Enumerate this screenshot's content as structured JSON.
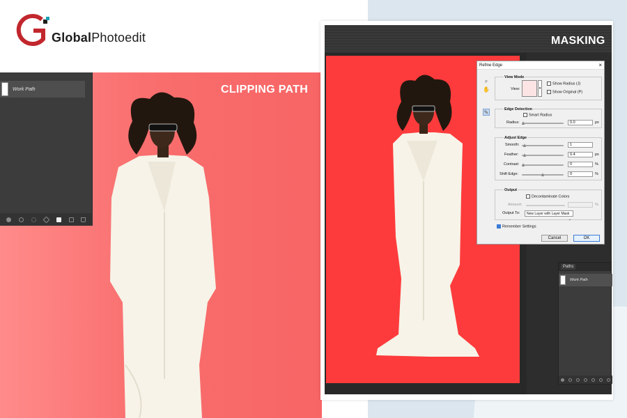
{
  "brand": {
    "name_bold": "Global",
    "name_regular": "Photoedit",
    "red": "#c1272d",
    "teal": "#1a9fb5"
  },
  "left": {
    "caption": "CLIPPING PATH",
    "paths_panel": {
      "row_label": "Work Path",
      "footer_icons": [
        "fill-path-icon",
        "stroke-path-icon",
        "load-selection-icon",
        "make-path-icon",
        "add-mask-icon",
        "new-path-icon",
        "trash-icon"
      ]
    },
    "background_color": "#f96e6e"
  },
  "right": {
    "caption": "MASKING",
    "background_color": "#fe3b3c",
    "dialog": {
      "title": "Refine Edge",
      "close": "×",
      "view_mode": {
        "title": "View Mode",
        "view_label": "View:",
        "show_radius": "Show Radius (J)",
        "show_original": "Show Original (P)"
      },
      "edge_detection": {
        "title": "Edge Detection",
        "smart_radius": "Smart Radius",
        "radius_label": "Radius:",
        "radius_value": "0.0",
        "radius_unit": "px"
      },
      "adjust_edge": {
        "title": "Adjust Edge",
        "rows": [
          {
            "label": "Smooth:",
            "value": "1",
            "unit": ""
          },
          {
            "label": "Feather:",
            "value": "0.4",
            "unit": "px"
          },
          {
            "label": "Contrast:",
            "value": "0",
            "unit": "%"
          },
          {
            "label": "Shift Edge:",
            "value": "0",
            "unit": "%"
          }
        ]
      },
      "output": {
        "title": "Output",
        "decontaminate": "Decontaminate Colors",
        "amount_label": "Amount:",
        "amount_unit": "%",
        "output_to_label": "Output To:",
        "output_to_value": "New Layer with Layer Mask"
      },
      "remember": "Remember Settings",
      "cancel": "Cancel",
      "ok": "OK"
    },
    "paths_panel": {
      "tab": "Paths",
      "row_label": "Work Path"
    }
  }
}
